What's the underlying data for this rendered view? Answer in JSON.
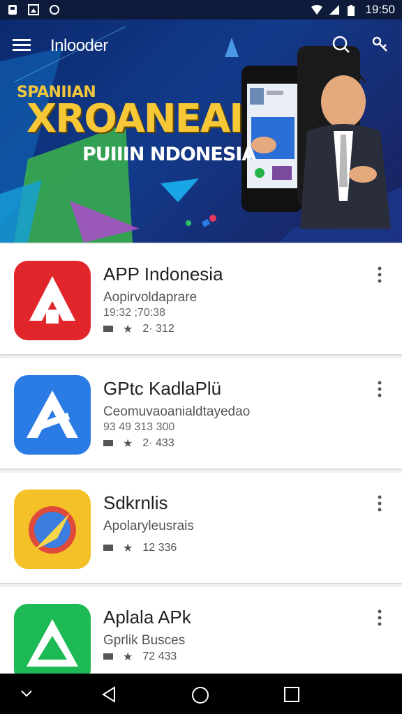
{
  "status_bar": {
    "time": "19:50",
    "icons_left": [
      "sim-icon",
      "image-icon",
      "circle-icon"
    ],
    "icons_right": [
      "wifi-icon",
      "signal-icon",
      "battery-icon"
    ]
  },
  "toolbar": {
    "title": "Inlooder",
    "menu_icon": "menu-icon",
    "search_icon": "search-icon",
    "share_icon": "share-icon"
  },
  "hero": {
    "subtitle": "SPANIIAN",
    "title": "XROANEAI",
    "tagline": "PUIIIN NDONESIA"
  },
  "apps": [
    {
      "name": "APP Indonesia",
      "subtitle": "Aopirvoldaprare",
      "meta": "19:32 ;70:38",
      "rating": "2· 312",
      "icon": "red-app-icon",
      "color": "#e0262b"
    },
    {
      "name": "GPtc KadlaPlü",
      "subtitle": "Ceomuvaoanialdtayedao",
      "meta": "93 49 313 300",
      "rating": "2· 433",
      "icon": "blue-app-icon",
      "color": "#2a7be4"
    },
    {
      "name": "Sdkrnlis",
      "subtitle": "Apolaryleusrais",
      "meta": "",
      "rating": "12 336",
      "icon": "yellow-app-icon",
      "color": "#f5c128"
    },
    {
      "name": "Aplala APk",
      "subtitle": "Gprlik Busces",
      "meta": "",
      "rating": "72 433",
      "icon": "green-app-icon",
      "color": "#1db954"
    }
  ],
  "navbar": {
    "icons": [
      "chevron-down-icon",
      "back-icon",
      "home-icon",
      "recents-icon"
    ]
  }
}
